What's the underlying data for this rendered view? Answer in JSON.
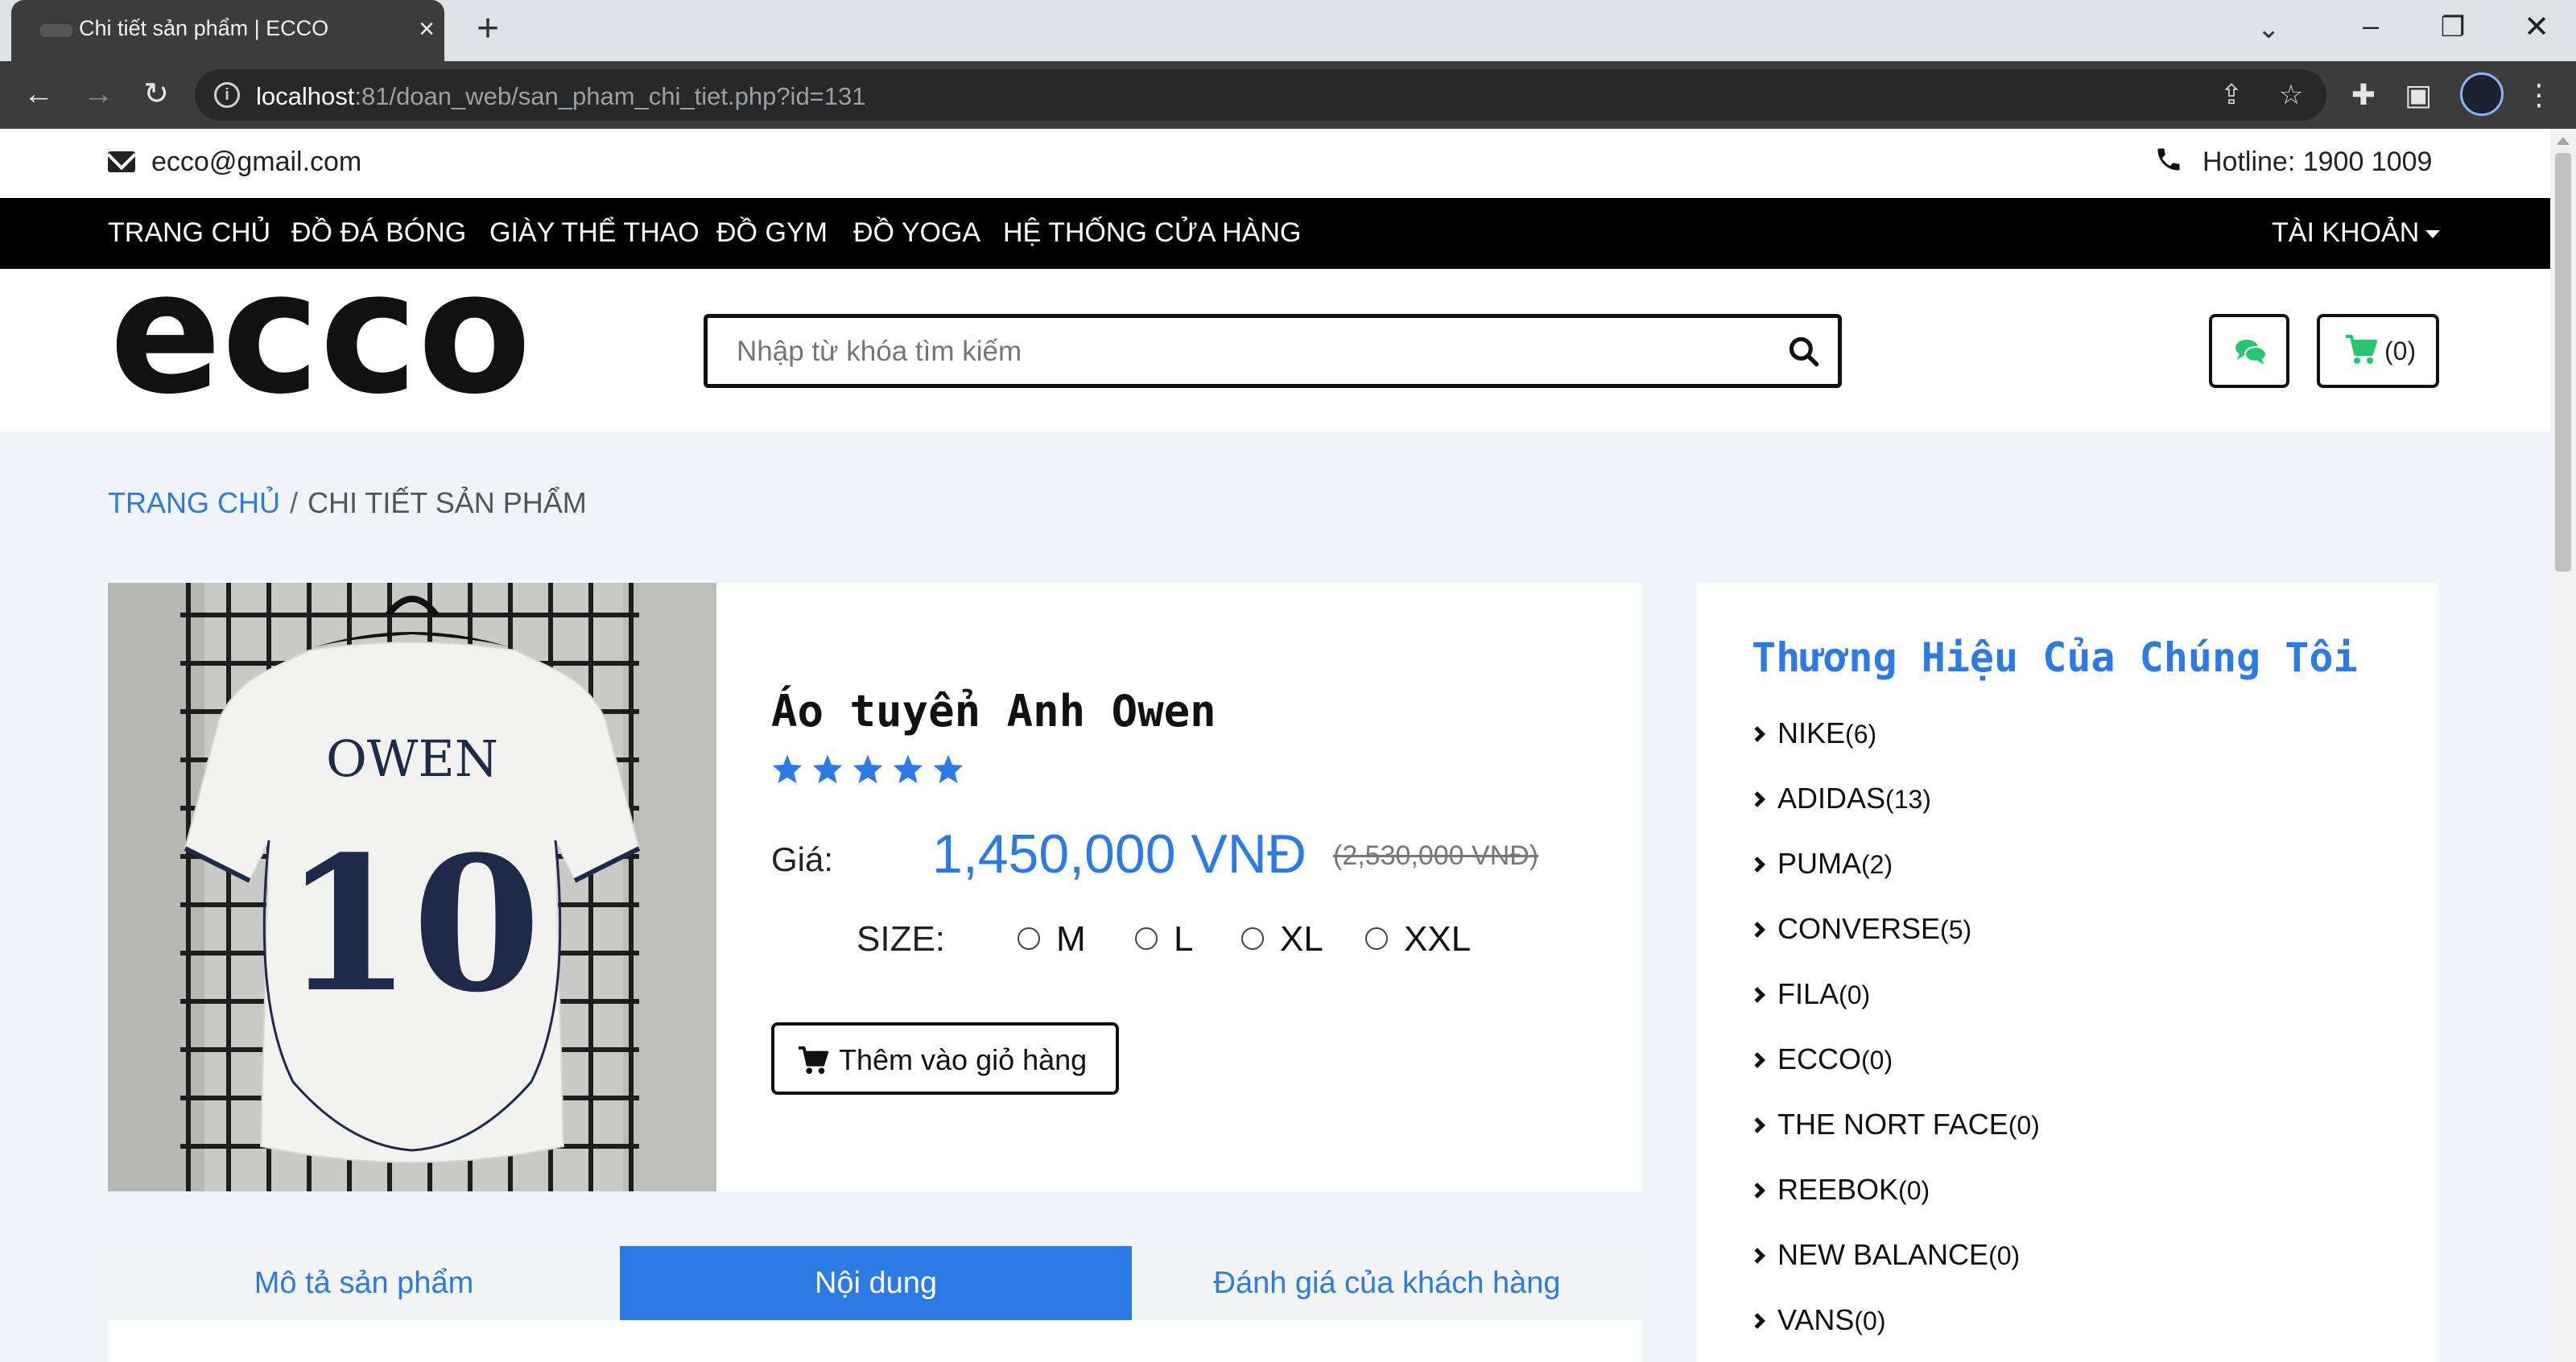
{
  "browser": {
    "tab_title": "Chi tiết sản phẩm | ECCO",
    "url_host": "localhost",
    "url_rest": ":81/doan_web/san_pham_chi_tiet.php?id=131"
  },
  "topbar": {
    "email": "ecco@gmail.com",
    "hotline": "Hotline: 1900 1009"
  },
  "nav": {
    "items": [
      "TRANG CHỦ",
      "ĐỒ ĐÁ BÓNG",
      "GIÀY THỂ THAO",
      "ĐỒ GYM",
      "ĐỒ YOGA",
      "HỆ THỐNG CỬA HÀNG"
    ],
    "account": "TÀI KHOẢN"
  },
  "header": {
    "logo_text": "ecco",
    "search_placeholder": "Nhập từ khóa tìm kiếm",
    "cart_count": "(0)"
  },
  "breadcrumb": {
    "home": "TRANG CHỦ",
    "separator": "/",
    "current": "CHI TIẾT SẢN PHẨM"
  },
  "product": {
    "name": "Áo tuyển Anh Owen",
    "rating_stars": 5,
    "price_label": "Giá:",
    "price": "1,450,000 VNĐ",
    "old_price": "(2,530,000 VNĐ)",
    "size_label": "SIZE:",
    "sizes": [
      "M",
      "L",
      "XL",
      "XXL"
    ],
    "add_to_cart": "Thêm vào giỏ hàng",
    "photo_jersey_name": "OWEN",
    "photo_jersey_number": "10"
  },
  "tabs": {
    "description": "Mô tả sản phẩm",
    "content": "Nội dung",
    "reviews": "Đánh giá của khách hàng"
  },
  "brands": {
    "title": "Thương Hiệu Của Chúng Tôi",
    "items": [
      {
        "name": "NIKE",
        "count": "(6)"
      },
      {
        "name": "ADIDAS",
        "count": "(13)"
      },
      {
        "name": "PUMA",
        "count": "(2)"
      },
      {
        "name": "CONVERSE",
        "count": "(5)"
      },
      {
        "name": "FILA",
        "count": "(0)"
      },
      {
        "name": "ECCO",
        "count": "(0)"
      },
      {
        "name": "THE NORT FACE",
        "count": "(0)"
      },
      {
        "name": "REEBOK",
        "count": "(0)"
      },
      {
        "name": "NEW BALANCE",
        "count": "(0)"
      },
      {
        "name": "VANS",
        "count": "(0)"
      }
    ]
  },
  "colors": {
    "accent": "#2c7be5",
    "nav_bg": "#000000",
    "page_bg": "#f1f4fa",
    "chat_green": "#28c76f"
  }
}
